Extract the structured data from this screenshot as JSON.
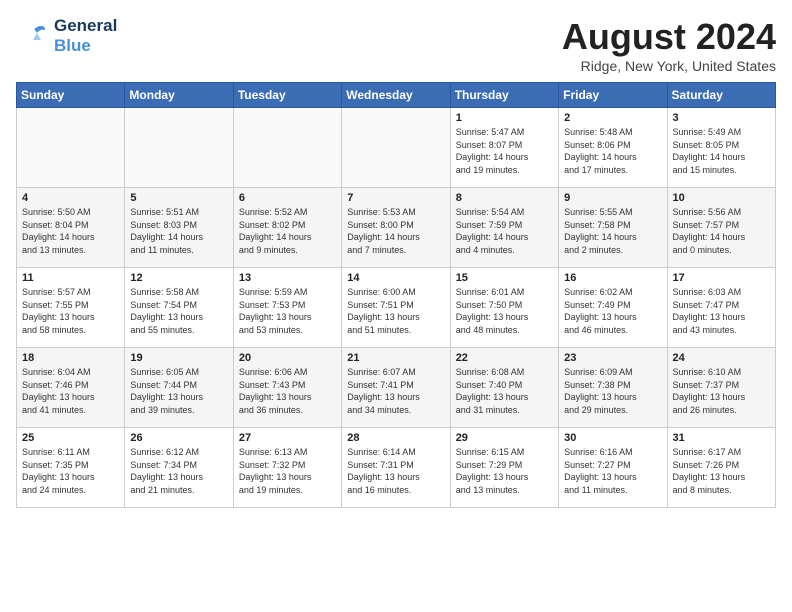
{
  "header": {
    "logo_general": "General",
    "logo_blue": "Blue",
    "month_title": "August 2024",
    "location": "Ridge, New York, United States"
  },
  "days_of_week": [
    "Sunday",
    "Monday",
    "Tuesday",
    "Wednesday",
    "Thursday",
    "Friday",
    "Saturday"
  ],
  "weeks": [
    [
      {
        "day": "",
        "info": ""
      },
      {
        "day": "",
        "info": ""
      },
      {
        "day": "",
        "info": ""
      },
      {
        "day": "",
        "info": ""
      },
      {
        "day": "1",
        "info": "Sunrise: 5:47 AM\nSunset: 8:07 PM\nDaylight: 14 hours\nand 19 minutes."
      },
      {
        "day": "2",
        "info": "Sunrise: 5:48 AM\nSunset: 8:06 PM\nDaylight: 14 hours\nand 17 minutes."
      },
      {
        "day": "3",
        "info": "Sunrise: 5:49 AM\nSunset: 8:05 PM\nDaylight: 14 hours\nand 15 minutes."
      }
    ],
    [
      {
        "day": "4",
        "info": "Sunrise: 5:50 AM\nSunset: 8:04 PM\nDaylight: 14 hours\nand 13 minutes."
      },
      {
        "day": "5",
        "info": "Sunrise: 5:51 AM\nSunset: 8:03 PM\nDaylight: 14 hours\nand 11 minutes."
      },
      {
        "day": "6",
        "info": "Sunrise: 5:52 AM\nSunset: 8:02 PM\nDaylight: 14 hours\nand 9 minutes."
      },
      {
        "day": "7",
        "info": "Sunrise: 5:53 AM\nSunset: 8:00 PM\nDaylight: 14 hours\nand 7 minutes."
      },
      {
        "day": "8",
        "info": "Sunrise: 5:54 AM\nSunset: 7:59 PM\nDaylight: 14 hours\nand 4 minutes."
      },
      {
        "day": "9",
        "info": "Sunrise: 5:55 AM\nSunset: 7:58 PM\nDaylight: 14 hours\nand 2 minutes."
      },
      {
        "day": "10",
        "info": "Sunrise: 5:56 AM\nSunset: 7:57 PM\nDaylight: 14 hours\nand 0 minutes."
      }
    ],
    [
      {
        "day": "11",
        "info": "Sunrise: 5:57 AM\nSunset: 7:55 PM\nDaylight: 13 hours\nand 58 minutes."
      },
      {
        "day": "12",
        "info": "Sunrise: 5:58 AM\nSunset: 7:54 PM\nDaylight: 13 hours\nand 55 minutes."
      },
      {
        "day": "13",
        "info": "Sunrise: 5:59 AM\nSunset: 7:53 PM\nDaylight: 13 hours\nand 53 minutes."
      },
      {
        "day": "14",
        "info": "Sunrise: 6:00 AM\nSunset: 7:51 PM\nDaylight: 13 hours\nand 51 minutes."
      },
      {
        "day": "15",
        "info": "Sunrise: 6:01 AM\nSunset: 7:50 PM\nDaylight: 13 hours\nand 48 minutes."
      },
      {
        "day": "16",
        "info": "Sunrise: 6:02 AM\nSunset: 7:49 PM\nDaylight: 13 hours\nand 46 minutes."
      },
      {
        "day": "17",
        "info": "Sunrise: 6:03 AM\nSunset: 7:47 PM\nDaylight: 13 hours\nand 43 minutes."
      }
    ],
    [
      {
        "day": "18",
        "info": "Sunrise: 6:04 AM\nSunset: 7:46 PM\nDaylight: 13 hours\nand 41 minutes."
      },
      {
        "day": "19",
        "info": "Sunrise: 6:05 AM\nSunset: 7:44 PM\nDaylight: 13 hours\nand 39 minutes."
      },
      {
        "day": "20",
        "info": "Sunrise: 6:06 AM\nSunset: 7:43 PM\nDaylight: 13 hours\nand 36 minutes."
      },
      {
        "day": "21",
        "info": "Sunrise: 6:07 AM\nSunset: 7:41 PM\nDaylight: 13 hours\nand 34 minutes."
      },
      {
        "day": "22",
        "info": "Sunrise: 6:08 AM\nSunset: 7:40 PM\nDaylight: 13 hours\nand 31 minutes."
      },
      {
        "day": "23",
        "info": "Sunrise: 6:09 AM\nSunset: 7:38 PM\nDaylight: 13 hours\nand 29 minutes."
      },
      {
        "day": "24",
        "info": "Sunrise: 6:10 AM\nSunset: 7:37 PM\nDaylight: 13 hours\nand 26 minutes."
      }
    ],
    [
      {
        "day": "25",
        "info": "Sunrise: 6:11 AM\nSunset: 7:35 PM\nDaylight: 13 hours\nand 24 minutes."
      },
      {
        "day": "26",
        "info": "Sunrise: 6:12 AM\nSunset: 7:34 PM\nDaylight: 13 hours\nand 21 minutes."
      },
      {
        "day": "27",
        "info": "Sunrise: 6:13 AM\nSunset: 7:32 PM\nDaylight: 13 hours\nand 19 minutes."
      },
      {
        "day": "28",
        "info": "Sunrise: 6:14 AM\nSunset: 7:31 PM\nDaylight: 13 hours\nand 16 minutes."
      },
      {
        "day": "29",
        "info": "Sunrise: 6:15 AM\nSunset: 7:29 PM\nDaylight: 13 hours\nand 13 minutes."
      },
      {
        "day": "30",
        "info": "Sunrise: 6:16 AM\nSunset: 7:27 PM\nDaylight: 13 hours\nand 11 minutes."
      },
      {
        "day": "31",
        "info": "Sunrise: 6:17 AM\nSunset: 7:26 PM\nDaylight: 13 hours\nand 8 minutes."
      }
    ]
  ]
}
